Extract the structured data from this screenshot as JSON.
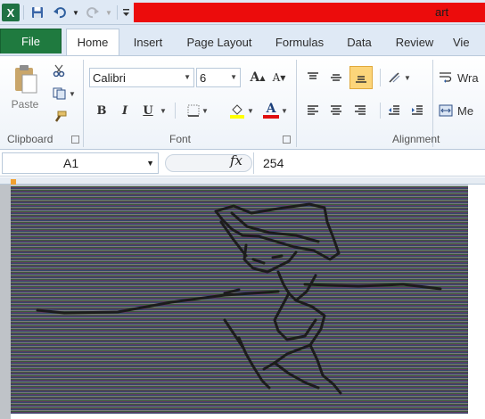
{
  "app": {
    "logo": "X",
    "title": "art"
  },
  "quick_access": {
    "icons": [
      "save-icon",
      "undo-icon",
      "redo-icon",
      "customize-icon"
    ]
  },
  "tabs": [
    {
      "label": "File",
      "active": false
    },
    {
      "label": "Home",
      "active": true
    },
    {
      "label": "Insert",
      "active": false
    },
    {
      "label": "Page Layout",
      "active": false
    },
    {
      "label": "Formulas",
      "active": false
    },
    {
      "label": "Data",
      "active": false
    },
    {
      "label": "Review",
      "active": false
    },
    {
      "label": "Vie",
      "active": false
    }
  ],
  "ribbon": {
    "clipboard": {
      "paste_label": "Paste",
      "group_label": "Clipboard"
    },
    "font": {
      "family": "Calibri",
      "size": "6",
      "group_label": "Font",
      "bold": "B",
      "italic": "I",
      "underline": "U",
      "grow": "A",
      "shrink": "A",
      "font_color": "A"
    },
    "alignment": {
      "group_label": "Alignment",
      "wrap_label": "Wra",
      "merge_label": "Me"
    }
  },
  "formula_bar": {
    "name_box": "A1",
    "fx": "fx",
    "value": "254"
  },
  "colors": {
    "file_tab": "#1f7a3f",
    "title_bar_highlight": "#ec0c0c",
    "fill_swatch": "#ffff00",
    "font_swatch": "#e01010",
    "active_cell": "#f0a030"
  }
}
